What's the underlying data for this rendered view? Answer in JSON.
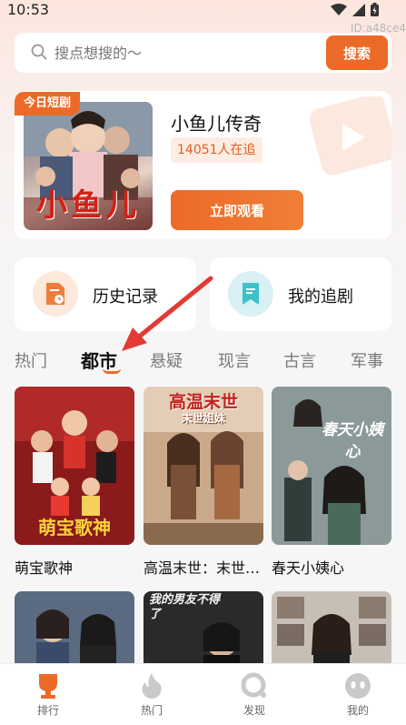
{
  "status": {
    "time": "10:53"
  },
  "id_tag": "ID:a48ce4",
  "search": {
    "placeholder": "搜点想搜的～",
    "button_label": "搜索"
  },
  "today": {
    "badge": "今日短剧",
    "title": "小鱼儿传奇",
    "watch_count": "14051人在追",
    "watch_button": "立即观看",
    "poster_art": "小鱼儿"
  },
  "quick": {
    "history": "历史记录",
    "following": "我的追剧"
  },
  "tabs": [
    "热门",
    "都市",
    "悬疑",
    "现言",
    "古言",
    "军事"
  ],
  "active_tab": "都市",
  "grid": [
    {
      "title": "萌宝歌神",
      "cover_art": "萌宝歌神"
    },
    {
      "title": "高温末世：末世姐妹",
      "cover_art": "高温末世",
      "cover_sub": "末世姐妹"
    },
    {
      "title": "春天小姨心",
      "cover_art": "春天小姨心"
    }
  ],
  "grid_row2": [
    {
      "cover_art": ""
    },
    {
      "cover_art": "我的男友不得了"
    },
    {
      "cover_art": ""
    }
  ],
  "nav": {
    "items": [
      "排行",
      "热门",
      "发现",
      "我的"
    ]
  },
  "colors": {
    "accent": "#ec6a28",
    "accent_light": "#fdece2"
  },
  "icons": [
    "search-icon",
    "history-icon",
    "bookmark-icon",
    "trophy-icon",
    "flame-icon",
    "discover-icon",
    "profile-icon",
    "wifi-icon",
    "signal-icon",
    "battery-icon"
  ]
}
